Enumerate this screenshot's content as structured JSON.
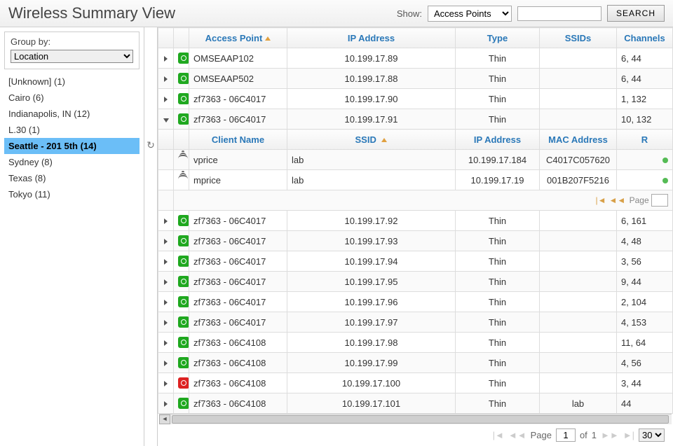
{
  "header": {
    "title": "Wireless Summary View",
    "show_label": "Show:",
    "show_select": "Access Points",
    "search_value": "",
    "search_button": "SEARCH"
  },
  "sidebar": {
    "group_by_label": "Group by:",
    "group_by_value": "Location",
    "items": [
      {
        "label": "[Unknown] (1)",
        "selected": false
      },
      {
        "label": "Cairo (6)",
        "selected": false
      },
      {
        "label": "Indianapolis, IN (12)",
        "selected": false
      },
      {
        "label": "L.30 (1)",
        "selected": false
      },
      {
        "label": "Seattle - 201 5th (14)",
        "selected": true
      },
      {
        "label": "Sydney (8)",
        "selected": false
      },
      {
        "label": "Texas (8)",
        "selected": false
      },
      {
        "label": "Tokyo (11)",
        "selected": false
      }
    ]
  },
  "grid": {
    "columns": {
      "ap": "Access Point",
      "ip": "IP Address",
      "type": "Type",
      "ssids": "SSIDs",
      "channels": "Channels"
    },
    "rows": [
      {
        "icon": "green",
        "name": "OMSEAAP102",
        "ip": "10.199.17.89",
        "type": "Thin",
        "ssids": "",
        "channels": "6, 44",
        "expanded": false
      },
      {
        "icon": "green",
        "name": "OMSEAAP502",
        "ip": "10.199.17.88",
        "type": "Thin",
        "ssids": "",
        "channels": "6, 44",
        "expanded": false
      },
      {
        "icon": "green",
        "name": "zf7363 - 06C4017",
        "ip": "10.199.17.90",
        "type": "Thin",
        "ssids": "",
        "channels": "1, 132",
        "expanded": false
      },
      {
        "icon": "green",
        "name": "zf7363 - 06C4017",
        "ip": "10.199.17.91",
        "type": "Thin",
        "ssids": "",
        "channels": "10, 132",
        "expanded": true
      },
      {
        "icon": "green",
        "name": "zf7363 - 06C4017",
        "ip": "10.199.17.92",
        "type": "Thin",
        "ssids": "",
        "channels": "6, 161",
        "expanded": false
      },
      {
        "icon": "green",
        "name": "zf7363 - 06C4017",
        "ip": "10.199.17.93",
        "type": "Thin",
        "ssids": "",
        "channels": "4, 48",
        "expanded": false
      },
      {
        "icon": "green",
        "name": "zf7363 - 06C4017",
        "ip": "10.199.17.94",
        "type": "Thin",
        "ssids": "",
        "channels": "3, 56",
        "expanded": false
      },
      {
        "icon": "green",
        "name": "zf7363 - 06C4017",
        "ip": "10.199.17.95",
        "type": "Thin",
        "ssids": "",
        "channels": "9, 44",
        "expanded": false
      },
      {
        "icon": "green",
        "name": "zf7363 - 06C4017",
        "ip": "10.199.17.96",
        "type": "Thin",
        "ssids": "",
        "channels": "2, 104",
        "expanded": false
      },
      {
        "icon": "green",
        "name": "zf7363 - 06C4017",
        "ip": "10.199.17.97",
        "type": "Thin",
        "ssids": "",
        "channels": "4, 153",
        "expanded": false
      },
      {
        "icon": "green",
        "name": "zf7363 - 06C4108",
        "ip": "10.199.17.98",
        "type": "Thin",
        "ssids": "",
        "channels": "11, 64",
        "expanded": false
      },
      {
        "icon": "green",
        "name": "zf7363 - 06C4108",
        "ip": "10.199.17.99",
        "type": "Thin",
        "ssids": "",
        "channels": "4, 56",
        "expanded": false
      },
      {
        "icon": "red",
        "name": "zf7363 - 06C4108",
        "ip": "10.199.17.100",
        "type": "Thin",
        "ssids": "",
        "channels": "3, 44",
        "expanded": false
      },
      {
        "icon": "green",
        "name": "zf7363 - 06C4108",
        "ip": "10.199.17.101",
        "type": "Thin",
        "ssids": "lab",
        "channels": "44",
        "expanded": false
      }
    ],
    "sub": {
      "columns": {
        "client": "Client Name",
        "ssid": "SSID",
        "ip": "IP Address",
        "mac": "MAC Address",
        "r": "R"
      },
      "rows": [
        {
          "client": "vprice",
          "ssid": "lab",
          "ip": "10.199.17.184",
          "mac": "C4017C057620",
          "r": "green"
        },
        {
          "client": "mprice",
          "ssid": "lab",
          "ip": "10.199.17.19",
          "mac": "001B207F5216",
          "r": "green"
        }
      ],
      "pager_label": "Page"
    }
  },
  "pager": {
    "label": "Page",
    "page": "1",
    "of": "of",
    "total": "1",
    "page_size": "30"
  }
}
